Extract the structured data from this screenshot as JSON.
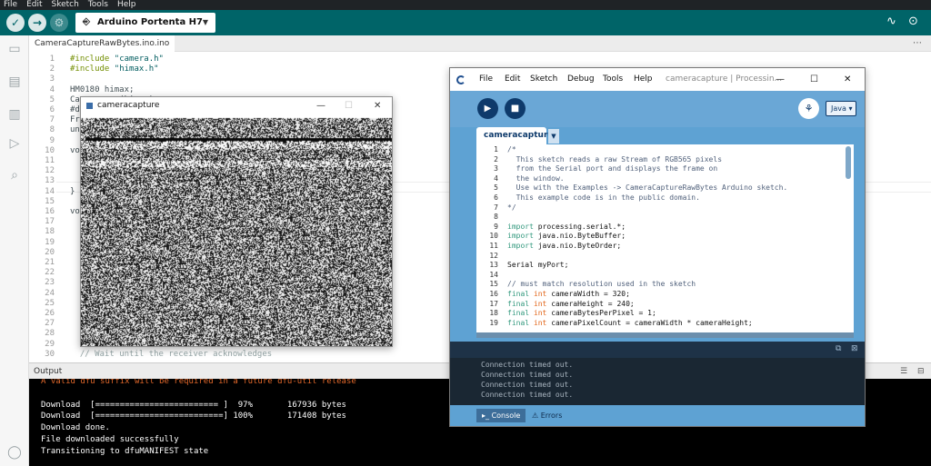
{
  "ide": {
    "menu": [
      "File",
      "Edit",
      "Sketch",
      "Tools",
      "Help"
    ],
    "board": "Arduino Portenta H7",
    "file_tab": "CameraCaptureRawBytes.ino.ino",
    "code_lines": [
      {
        "n": "1",
        "html": "<span class=\"kw\">#include</span> <span class=\"str\">\"camera.h\"</span>"
      },
      {
        "n": "2",
        "html": "<span class=\"kw\">#include</span> <span class=\"str\">\"himax.h\"</span>"
      },
      {
        "n": "3",
        "html": ""
      },
      {
        "n": "4",
        "html": "HM0180 himax;"
      },
      {
        "n": "5",
        "html": "Camera cam(himax);"
      },
      {
        "n": "6",
        "html": "#define IMAGE_MODE CAMERA_GRAYSCALE"
      },
      {
        "n": "7",
        "html": "FrameBuffer fb(320,240,2);"
      },
      {
        "n": "8",
        "html": "unsigned long lastUpdate = 0;"
      },
      {
        "n": "9",
        "html": ""
      },
      {
        "n": "10",
        "html": "void setup() {"
      },
      {
        "n": "11",
        "html": ""
      },
      {
        "n": "12",
        "html": ""
      },
      {
        "n": "13",
        "html": ""
      },
      {
        "n": "14",
        "html": "}"
      },
      {
        "n": "15",
        "html": ""
      },
      {
        "n": "16",
        "html": "void loop() {"
      },
      {
        "n": "17",
        "html": ""
      },
      {
        "n": "18",
        "html": ""
      },
      {
        "n": "19",
        "html": ""
      },
      {
        "n": "20",
        "html": ""
      },
      {
        "n": "21",
        "html": ""
      },
      {
        "n": "22",
        "html": ""
      },
      {
        "n": "23",
        "html": ""
      },
      {
        "n": "24",
        "html": ""
      },
      {
        "n": "25",
        "html": ""
      },
      {
        "n": "26",
        "html": ""
      },
      {
        "n": "27",
        "html": ""
      },
      {
        "n": "28",
        "html": ""
      },
      {
        "n": "29",
        "html": ""
      },
      {
        "n": "30",
        "html": "  <span class=\"cm\">// Wait until the receiver acknowledges</span>"
      }
    ],
    "output_title": "Output",
    "output_lines": [
      {
        "text": "A valid dfu suffix will be required in a future dfu-util release",
        "cls": "warn"
      },
      {
        "text": "",
        "cls": ""
      },
      {
        "text": "Download  [========================= ]  97%       167936 bytes",
        "cls": ""
      },
      {
        "text": "Download  [==========================] 100%       171408 bytes",
        "cls": ""
      },
      {
        "text": "Download done.",
        "cls": ""
      },
      {
        "text": "File downloaded successfully",
        "cls": ""
      },
      {
        "text": "Transitioning to dfuMANIFEST state",
        "cls": ""
      }
    ]
  },
  "camera_window": {
    "title": "cameracapture"
  },
  "processing": {
    "menu": [
      "File",
      "Edit",
      "Sketch",
      "Debug",
      "Tools",
      "Help"
    ],
    "window_title": "cameracapture | Processin...",
    "mode": "Java ▾",
    "tab": "cameracapture",
    "code": [
      {
        "n": "1",
        "html": "<span class=\"cm\">/*</span>"
      },
      {
        "n": "2",
        "html": "<span class=\"cm\">  This sketch reads a raw Stream of RGB565 pixels</span>"
      },
      {
        "n": "3",
        "html": "<span class=\"cm\">  from the Serial port and displays the frame on</span>"
      },
      {
        "n": "4",
        "html": "<span class=\"cm\">  the window.</span>"
      },
      {
        "n": "5",
        "html": "<span class=\"cm\">  Use with the Examples -&gt; CameraCaptureRawBytes Arduino sketch.</span>"
      },
      {
        "n": "6",
        "html": "<span class=\"cm\">  This example code is in the public domain.</span>"
      },
      {
        "n": "7",
        "html": "<span class=\"cm\">*/</span>"
      },
      {
        "n": "8",
        "html": ""
      },
      {
        "n": "9",
        "html": "<span class=\"kw\">import</span> processing.serial.*;"
      },
      {
        "n": "10",
        "html": "<span class=\"kw\">import</span> java.nio.ByteBuffer;"
      },
      {
        "n": "11",
        "html": "<span class=\"kw\">import</span> java.nio.ByteOrder;"
      },
      {
        "n": "12",
        "html": ""
      },
      {
        "n": "13",
        "html": "Serial myPort;"
      },
      {
        "n": "14",
        "html": ""
      },
      {
        "n": "15",
        "html": "<span class=\"cm\">// must match resolution used in the sketch</span>"
      },
      {
        "n": "16",
        "html": "<span class=\"kw\">final</span> <span class=\"ty\">int</span> cameraWidth = 320;"
      },
      {
        "n": "17",
        "html": "<span class=\"kw\">final</span> <span class=\"ty\">int</span> cameraHeight = 240;"
      },
      {
        "n": "18",
        "html": "<span class=\"kw\">final</span> <span class=\"ty\">int</span> cameraBytesPerPixel = 1;"
      },
      {
        "n": "19",
        "html": "<span class=\"kw\">final</span> <span class=\"ty\">int</span> cameraPixelCount = cameraWidth * cameraHeight;"
      }
    ],
    "console": [
      "Connection timed out.",
      "Connection timed out.",
      "Connection timed out.",
      "Connection timed out."
    ],
    "footer_tabs": [
      "Console",
      "Errors"
    ]
  }
}
